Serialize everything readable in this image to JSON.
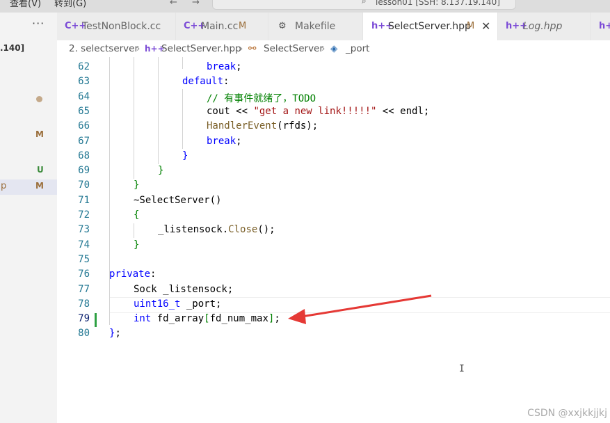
{
  "menubar": {
    "view": "查看(V)",
    "goto": "转到(G)",
    "search": "lesson01 [SSH: 8.137.19.140]"
  },
  "sidebar": {
    "more": "···",
    "ip_fragment": ".140]",
    "badges": [
      {
        "text": "M",
        "color": "#9a6e3a"
      },
      {
        "text": "U",
        "color": "#3b8b3b"
      },
      {
        "text": "M",
        "color": "#9a6e3a"
      }
    ],
    "selected_fragment": "p"
  },
  "tabs": [
    {
      "label": "TestNonBlock.cc",
      "icon": "C++",
      "modified": ""
    },
    {
      "label": "Main.cc",
      "icon": "C++",
      "modified": "M"
    },
    {
      "label": "Makefile",
      "icon": "makefile-icon",
      "modified": ""
    },
    {
      "label": "SelectServer.hpp",
      "icon": "h++",
      "modified": "M",
      "active": true
    },
    {
      "label": "Log.hpp",
      "icon": "h++",
      "modified": ""
    },
    {
      "label": "",
      "icon": "h++",
      "modified": ""
    }
  ],
  "breadcrumb": {
    "folder": "2. selectserver",
    "file": "SelectServer.hpp",
    "cls": "SelectServer",
    "member": "_port"
  },
  "code": {
    "lines": [
      {
        "n": "62",
        "indent": 4,
        "tokens": [
          {
            "t": "break",
            "c": "kw"
          },
          {
            "t": ";",
            "c": ""
          }
        ]
      },
      {
        "n": "63",
        "indent": 3,
        "tokens": [
          {
            "t": "default",
            "c": "kw"
          },
          {
            "t": ":",
            "c": ""
          }
        ]
      },
      {
        "n": "64",
        "indent": 4,
        "tokens": [
          {
            "t": "// 有事件就绪了，TODO",
            "c": "cm"
          }
        ]
      },
      {
        "n": "65",
        "indent": 4,
        "tokens": [
          {
            "t": "cout << ",
            "c": ""
          },
          {
            "t": "\"get a new link!!!!!\"",
            "c": "st"
          },
          {
            "t": " << endl;",
            "c": ""
          }
        ]
      },
      {
        "n": "66",
        "indent": 4,
        "tokens": [
          {
            "t": "HandlerEvent",
            "c": "fn"
          },
          {
            "t": "(rfds);",
            "c": ""
          }
        ]
      },
      {
        "n": "67",
        "indent": 4,
        "tokens": [
          {
            "t": "break",
            "c": "kw"
          },
          {
            "t": ";",
            "c": ""
          }
        ]
      },
      {
        "n": "68",
        "indent": 3,
        "tokens": [
          {
            "t": "}",
            "c": "kw"
          }
        ]
      },
      {
        "n": "69",
        "indent": 2,
        "tokens": [
          {
            "t": "}",
            "c": "cm"
          }
        ]
      },
      {
        "n": "70",
        "indent": 1,
        "tokens": [
          {
            "t": "}",
            "c": "cm"
          }
        ]
      },
      {
        "n": "71",
        "indent": 1,
        "tokens": [
          {
            "t": "~SelectServer",
            "c": ""
          },
          {
            "t": "()",
            "c": ""
          }
        ]
      },
      {
        "n": "72",
        "indent": 1,
        "tokens": [
          {
            "t": "{",
            "c": "cm"
          }
        ]
      },
      {
        "n": "73",
        "indent": 2,
        "tokens": [
          {
            "t": "_listensock.",
            "c": ""
          },
          {
            "t": "Close",
            "c": "fn"
          },
          {
            "t": "();",
            "c": ""
          }
        ]
      },
      {
        "n": "74",
        "indent": 1,
        "tokens": [
          {
            "t": "}",
            "c": "cm"
          }
        ]
      },
      {
        "n": "75",
        "indent": 0,
        "tokens": []
      },
      {
        "n": "76",
        "indent": 0,
        "tokens": [
          {
            "t": "private",
            "c": "kw"
          },
          {
            "t": ":",
            "c": ""
          }
        ]
      },
      {
        "n": "77",
        "indent": 1,
        "tokens": [
          {
            "t": "Sock _listensock;",
            "c": ""
          }
        ]
      },
      {
        "n": "78",
        "indent": 1,
        "tokens": [
          {
            "t": "uint16_t",
            "c": "kw"
          },
          {
            "t": " _port;",
            "c": ""
          }
        ]
      },
      {
        "n": "79",
        "indent": 1,
        "tokens": [
          {
            "t": "int",
            "c": "kw"
          },
          {
            "t": " fd_array",
            "c": ""
          },
          {
            "t": "[",
            "c": "cm"
          },
          {
            "t": "fd_num_max",
            "c": ""
          },
          {
            "t": "]",
            "c": "cm"
          },
          {
            "t": ";",
            "c": ""
          }
        ]
      },
      {
        "n": "80",
        "indent": 0,
        "tokens": [
          {
            "t": "}",
            "c": "kw"
          },
          {
            "t": ";",
            "c": ""
          }
        ]
      }
    ]
  },
  "watermark": "CSDN @xxjkkjjkj"
}
